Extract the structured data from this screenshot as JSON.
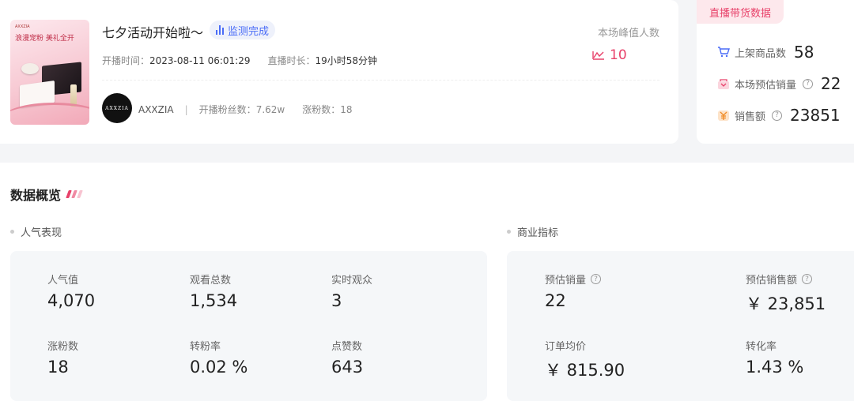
{
  "live": {
    "title": "七夕活动开始啦～",
    "status": "监测完成",
    "start_label": "开播时间：",
    "start_value": "2023-08-11 06:01:29",
    "duration_label": "直播时长：",
    "duration_value": "19小时58分钟",
    "peak_label": "本场峰值人数",
    "peak_value": "10",
    "cover": {
      "title": "浪漫宠粉 美礼全开",
      "brand": "AXXZIA"
    }
  },
  "anchor": {
    "avatar_text": "AXXZIA",
    "name": "AXXZIA",
    "separator": "|",
    "fans_label": "开播粉丝数：",
    "fans_value": "7.62w",
    "gain_label": "涨粉数：",
    "gain_value": "18"
  },
  "side": {
    "tag": "直播带货数据",
    "rows": [
      {
        "label": "上架商品数",
        "value": "58",
        "icon": "cart-icon"
      },
      {
        "label": "本场预估销量",
        "value": "22",
        "icon": "sales-icon"
      },
      {
        "label": "销售额",
        "value": "23851",
        "icon": "yen-icon"
      }
    ]
  },
  "overview": {
    "title": "数据概览",
    "popularity": {
      "heading": "人气表现",
      "metrics": [
        {
          "label": "人气值",
          "value": "4,070"
        },
        {
          "label": "观看总数",
          "value": "1,534"
        },
        {
          "label": "实时观众",
          "value": "3"
        },
        {
          "label": "涨粉数",
          "value": "18"
        },
        {
          "label": "转粉率",
          "value": "0.02 %"
        },
        {
          "label": "点赞数",
          "value": "643"
        }
      ]
    },
    "business": {
      "heading": "商业指标",
      "metrics": [
        {
          "label": "预估销量",
          "value": "22"
        },
        {
          "label": "预估销售额",
          "value": "￥ 23,851"
        },
        {
          "label": "订单均价",
          "value": "￥ 815.90"
        },
        {
          "label": "转化率",
          "value": "1.43 %"
        }
      ]
    }
  },
  "colors": {
    "accent_pink": "#e8426a",
    "accent_blue": "#4a6cf7",
    "panel_bg": "#f5f7f9"
  }
}
